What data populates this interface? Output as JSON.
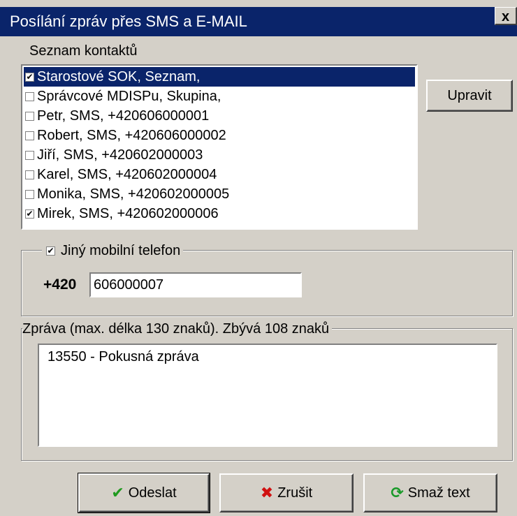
{
  "window": {
    "title": "Posílání zpráv přes SMS a E-MAIL",
    "close_label": "x"
  },
  "contacts": {
    "label": "Seznam kontaktů",
    "items": [
      {
        "label": "Starostové SOK, Seznam,",
        "checked": true,
        "selected": true
      },
      {
        "label": "Správcové MDISPu, Skupina,",
        "checked": false,
        "selected": false
      },
      {
        "label": "Petr, SMS, +420606000001",
        "checked": false,
        "selected": false
      },
      {
        "label": "Robert, SMS, +420606000002",
        "checked": false,
        "selected": false
      },
      {
        "label": "Jiří, SMS, +420602000003",
        "checked": false,
        "selected": false
      },
      {
        "label": "Karel, SMS, +420602000004",
        "checked": false,
        "selected": false
      },
      {
        "label": "Monika, SMS, +420602000005",
        "checked": false,
        "selected": false
      },
      {
        "label": "Mirek, SMS, +420602000006",
        "checked": true,
        "selected": false
      }
    ],
    "edit_button": "Upravit"
  },
  "other_phone": {
    "label": "Jiný mobilní telefon",
    "checked": true,
    "prefix": "+420",
    "value": "606000007"
  },
  "message": {
    "label": "Zpráva (max. délka 130 znaků). Zbývá 108 znaků",
    "value": "13550 - Pokusná zpráva"
  },
  "buttons": {
    "send": "Odeslat",
    "cancel": "Zrušit",
    "clear": "Smaž text"
  },
  "colors": {
    "title_bar": "#0a246a",
    "face": "#d4d0c8",
    "send_icon": "#1f9a1f",
    "cancel_icon": "#d01010",
    "clear_icon": "#1a9a2a"
  },
  "icons": {
    "send": "checkmark-icon",
    "cancel": "x-mark-icon",
    "clear": "refresh-icon"
  }
}
